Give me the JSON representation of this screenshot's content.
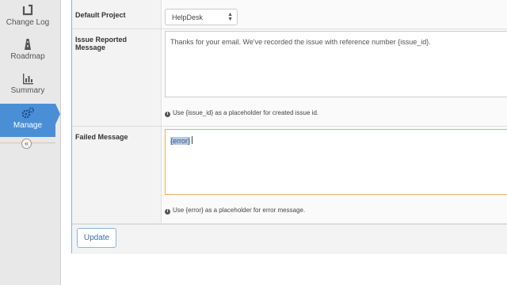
{
  "sidebar": {
    "items": [
      {
        "label": "Change Log",
        "icon": "change-log-icon"
      },
      {
        "label": "Roadmap",
        "icon": "roadmap-icon"
      },
      {
        "label": "Summary",
        "icon": "summary-icon"
      },
      {
        "label": "Manage",
        "icon": "manage-icon",
        "active": true
      }
    ],
    "collapse_icon": "«"
  },
  "form": {
    "default_project": {
      "label": "Default Project",
      "value": "HelpDesk"
    },
    "issue_reported": {
      "label": "Issue Reported Message",
      "value": "Thanks for your email.  We've recorded the issue with reference number {issue_id}.",
      "hint": "Use {issue_id} as a placeholder for created issue id."
    },
    "failed": {
      "label": "Failed Message",
      "value": "{error}",
      "hint": "Use {error} as a placeholder for error message."
    },
    "update_label": "Update",
    "info_icon": "i"
  },
  "colors": {
    "accent": "#4a8fd6",
    "focus_border": "#e8b15c",
    "selection": "#b8cbe4"
  }
}
